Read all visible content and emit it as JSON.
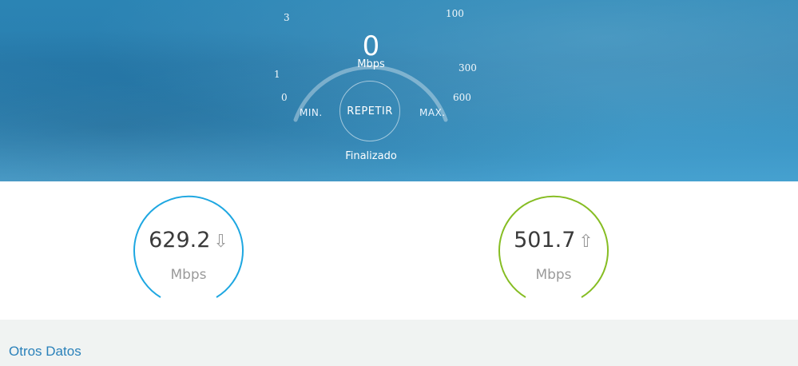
{
  "gauge": {
    "current_value": "0",
    "unit": "Mbps",
    "scale_labels": {
      "s0": "0",
      "s1": "1",
      "s3": "3",
      "s100": "100",
      "s300": "300",
      "s600": "600"
    },
    "min_label": "MIN.",
    "max_label": "MAX.",
    "repeat_button": "REPETIR",
    "status": "Finalizado"
  },
  "results": {
    "download": {
      "value": "629.2",
      "unit": "Mbps",
      "icon": "download-arrow-icon",
      "color": "#1ea7e1"
    },
    "upload": {
      "value": "501.7",
      "unit": "Mbps",
      "icon": "upload-arrow-icon",
      "color": "#86bd23"
    }
  },
  "other_section": {
    "title": "Otros Datos"
  }
}
